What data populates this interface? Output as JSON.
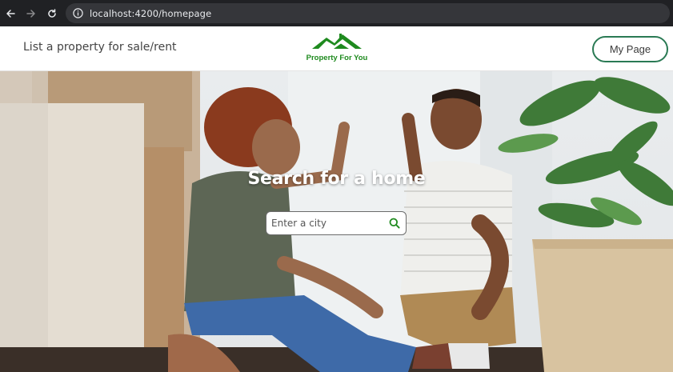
{
  "browser": {
    "url": "localhost:4200/homepage",
    "icons": [
      "back-arrow-icon",
      "forward-arrow-icon",
      "reload-icon",
      "site-info-icon"
    ]
  },
  "header": {
    "list_property_label": "List a property for sale/rent",
    "logo_text": "Property For You",
    "my_page_label": "My Page"
  },
  "hero": {
    "title": "Search for a home",
    "search": {
      "placeholder": "Enter a city",
      "value": ""
    }
  },
  "colors": {
    "brand_green": "#1e8a1e",
    "button_border": "#2a7a54",
    "browser_bar": "#202124"
  }
}
